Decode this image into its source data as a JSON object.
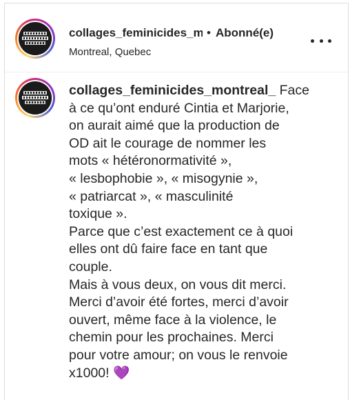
{
  "post_header": {
    "username": "collages_feminicides_montreal_",
    "separator": "•",
    "follow_status": "Abonné(e)",
    "location": "Montreal, Quebec",
    "avatar_icon": "collages-feminicides-logo-icon",
    "more_icon": "more-options-icon"
  },
  "comment": {
    "author": "collages_feminicides_montreal_",
    "first_line_rest": " Face",
    "lines": [
      "à ce qu’ont enduré Cintia et Marjorie,",
      "on aurait aimé que la production de",
      "OD ait le courage de nommer les",
      "mots « hétéronormativité »,",
      "« lesbophobie », « misogynie »,",
      "« patriarcat », « masculinité",
      "toxique ».",
      "Parce que c’est exactement ce à quoi",
      "elles ont dû faire face en tant que",
      "couple.",
      "Mais à vous deux, on vous dit merci.",
      "Merci d’avoir été fortes, merci d’avoir",
      "ouvert, même face à la violence, le",
      "chemin pour les prochaines. Merci",
      "pour votre amour; on vous le renvoie"
    ],
    "last_line": "x1000! ",
    "emoji": "💜"
  },
  "colors": {
    "text": "#262626",
    "border": "#dbdbdb",
    "purple_heart": "#a23fe0"
  }
}
